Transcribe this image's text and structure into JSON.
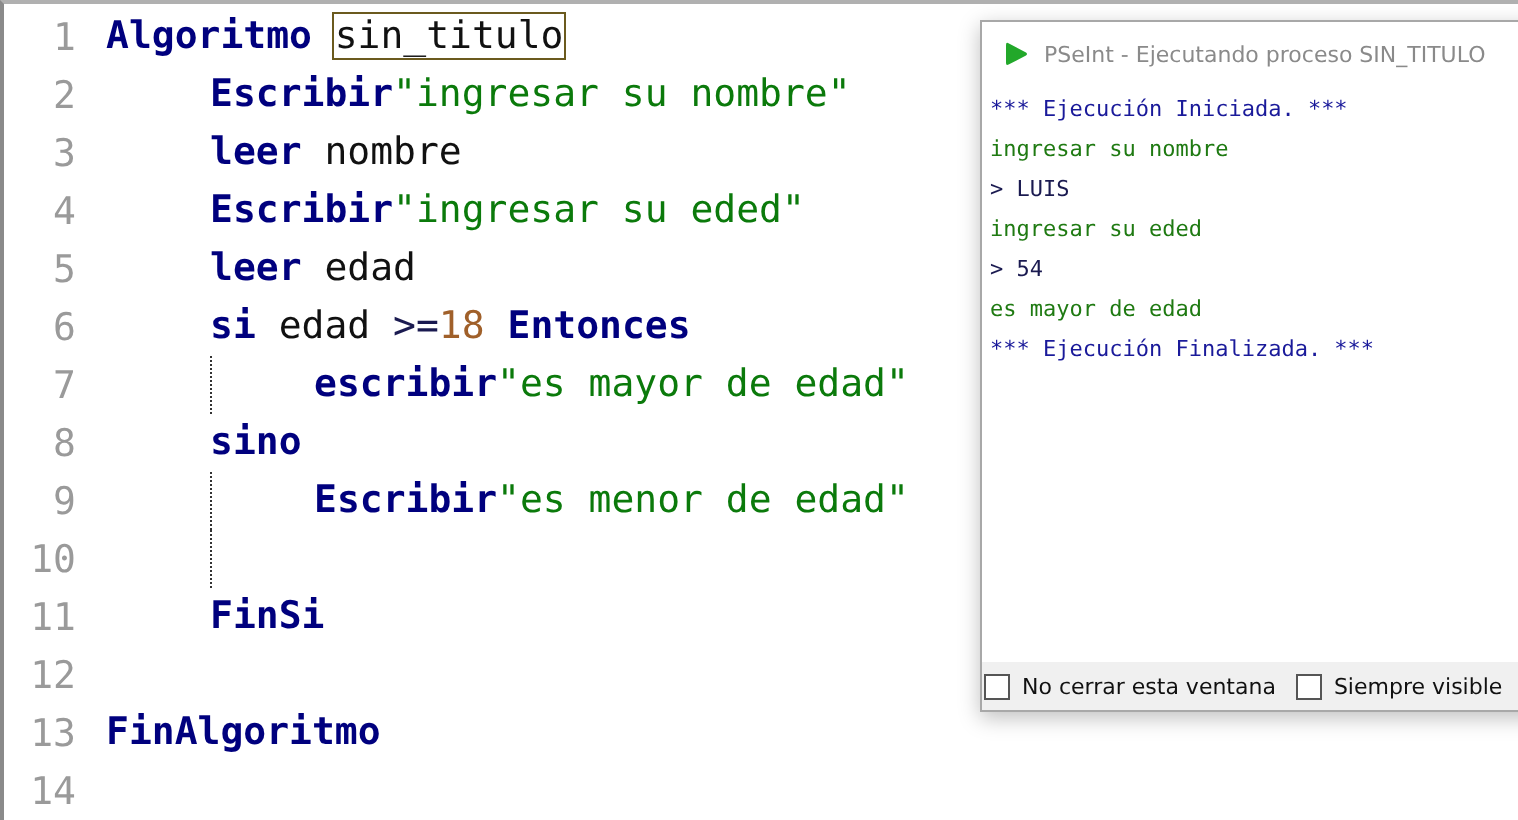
{
  "editor": {
    "lines": [
      {
        "number": "1",
        "tokens": [
          {
            "kind": "keyword",
            "text": "Algoritmo"
          },
          {
            "kind": "name",
            "text": "sin_titulo"
          }
        ],
        "guides": false,
        "children": [
          {
            "number": "2",
            "tokens": [
              {
                "kind": "keyword",
                "text": "Escribir"
              },
              {
                "kind": "string",
                "text": "\"ingresar su nombre\""
              }
            ]
          },
          {
            "number": "3",
            "tokens": [
              {
                "kind": "keyword",
                "text": "leer"
              },
              {
                "kind": "text",
                "text": " nombre"
              }
            ]
          },
          {
            "number": "4",
            "tokens": [
              {
                "kind": "keyword",
                "text": "Escribir"
              },
              {
                "kind": "string",
                "text": "\"ingresar su eded\""
              }
            ]
          },
          {
            "number": "5",
            "tokens": [
              {
                "kind": "keyword",
                "text": "leer"
              },
              {
                "kind": "text",
                "text": " edad"
              }
            ]
          },
          {
            "number": "6",
            "tokens": [
              {
                "kind": "keyword",
                "text": "si"
              },
              {
                "kind": "text",
                "text": " edad "
              },
              {
                "kind": "operator",
                "text": ">="
              },
              {
                "kind": "number",
                "text": "18"
              },
              {
                "kind": "keyword",
                "text": " Entonces"
              }
            ],
            "guides": true,
            "children": [
              {
                "number": "7",
                "tokens": [
                  {
                    "kind": "keyword",
                    "text": "escribir"
                  },
                  {
                    "kind": "string",
                    "text": "\"es mayor de edad\""
                  }
                ]
              }
            ]
          },
          {
            "number": "8",
            "tokens": [
              {
                "kind": "keyword",
                "text": "sino"
              }
            ],
            "guides": true,
            "children": [
              {
                "number": "9",
                "tokens": [
                  {
                    "kind": "keyword",
                    "text": "Escribir"
                  },
                  {
                    "kind": "string",
                    "text": "\"es menor de edad\""
                  }
                ]
              },
              {
                "number": "10"
              }
            ]
          },
          {
            "number": "11",
            "tokens": [
              {
                "kind": "keyword",
                "text": "FinSi"
              }
            ]
          },
          {
            "number": "12"
          }
        ]
      },
      {
        "number": "13",
        "tokens": [
          {
            "kind": "keyword",
            "text": "FinAlgoritmo"
          }
        ]
      },
      {
        "number": "14"
      }
    ]
  },
  "console": {
    "title": "PSeInt - Ejecutando proceso SIN_TITULO",
    "lines": [
      {
        "kind": "info",
        "text": "*** Ejecución Iniciada. ***"
      },
      {
        "kind": "output",
        "text": "ingresar su nombre"
      },
      {
        "kind": "input",
        "text": "> LUIS"
      },
      {
        "kind": "output",
        "text": "ingresar su eded"
      },
      {
        "kind": "input",
        "text": "> 54"
      },
      {
        "kind": "output",
        "text": "es mayor de edad"
      },
      {
        "kind": "info",
        "text": "*** Ejecución Finalizada. ***"
      }
    ],
    "options": [
      {
        "label": "No cerrar esta ventana",
        "checked": false
      },
      {
        "label": "Siempre visible",
        "checked": false
      }
    ]
  }
}
